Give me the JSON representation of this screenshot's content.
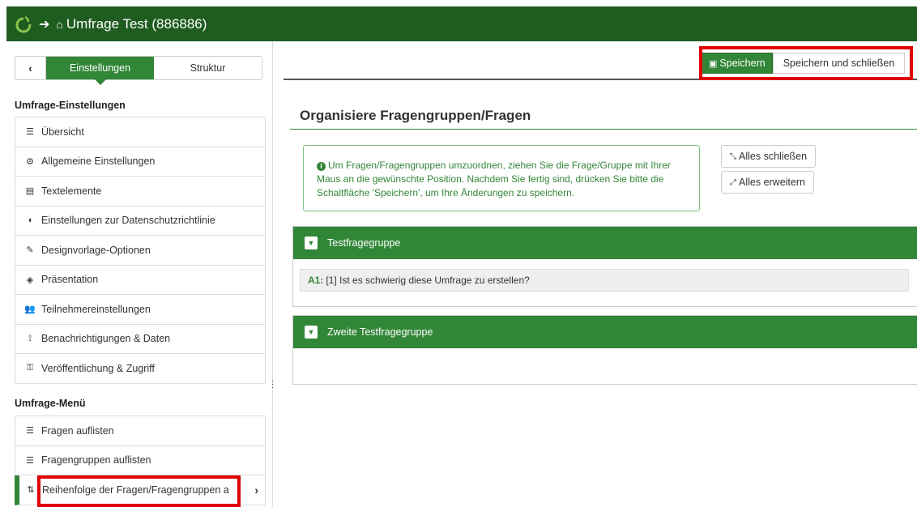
{
  "topbar": {
    "title": "Umfrage Test (886886)",
    "logo_icon": "limesurvey-logo-icon",
    "arrow_icon": "arrow-right-icon",
    "home_icon": "home-icon"
  },
  "sidebar": {
    "back_icon": "‹",
    "tabs": [
      {
        "label": "Einstellungen",
        "active": true
      },
      {
        "label": "Struktur",
        "active": false
      }
    ],
    "settings_title": "Umfrage-Einstellungen",
    "settings_items": [
      {
        "label": "Übersicht",
        "icon": "list-icon",
        "glyph": "☰"
      },
      {
        "label": "Allgemeine Einstellungen",
        "icon": "cogs-icon",
        "glyph": "⚙"
      },
      {
        "label": "Textelemente",
        "icon": "file-text-icon",
        "glyph": "▤"
      },
      {
        "label": "Einstellungen zur Datenschutzrichtlinie",
        "icon": "shield-icon",
        "glyph": "◖"
      },
      {
        "label": "Designvorlage-Optionen",
        "icon": "paint-brush-icon",
        "glyph": "✎"
      },
      {
        "label": "Präsentation",
        "icon": "eye-slash-icon",
        "glyph": "◈"
      },
      {
        "label": "Teilnehmereinstellungen",
        "icon": "users-icon",
        "glyph": "👥"
      },
      {
        "label": "Benachrichtigungen & Daten",
        "icon": "rss-icon",
        "glyph": "⟟"
      },
      {
        "label": "Veröffentlichung & Zugriff",
        "icon": "key-icon",
        "glyph": "⚿"
      }
    ],
    "menu_title": "Umfrage-Menü",
    "menu_items": [
      {
        "label": "Fragen auflisten",
        "icon": "list-icon",
        "glyph": "☰"
      },
      {
        "label": "Fragengruppen auflisten",
        "icon": "list-icon",
        "glyph": "☰"
      },
      {
        "label": "Reihenfolge der Fragen/Fragengruppen a",
        "icon": "sort-icon",
        "glyph": "⇅",
        "active": true
      }
    ],
    "active_chevron": "›"
  },
  "toolbar": {
    "save_label": "Speichern",
    "save_close_label": "Speichern und schließen",
    "save_icon": "floppy-disk-icon"
  },
  "main": {
    "title": "Organisiere Fragengruppen/Fragen",
    "info_text": "Um Fragen/Fragengruppen umzuordnen, ziehen Sie die Frage/Gruppe mit Ihrer Maus an die gewünschte Position. Nachdem Sie fertig sind, drücken Sie bitte die Schaltfläche 'Speichern', um Ihre Änderungen zu speichern.",
    "collapse_all_label": "Alles schließen",
    "expand_all_label": "Alles erweitern",
    "groups": [
      {
        "name": "Testfragegruppe",
        "questions": [
          {
            "code": "A1:",
            "text": "[1] Ist es schwierig diese Umfrage zu erstellen?"
          }
        ]
      },
      {
        "name": "Zweite Testfragegruppe",
        "questions": []
      }
    ]
  },
  "colors": {
    "topbar": "#1f5c20",
    "accent": "#328637",
    "highlight": "#e00000"
  }
}
